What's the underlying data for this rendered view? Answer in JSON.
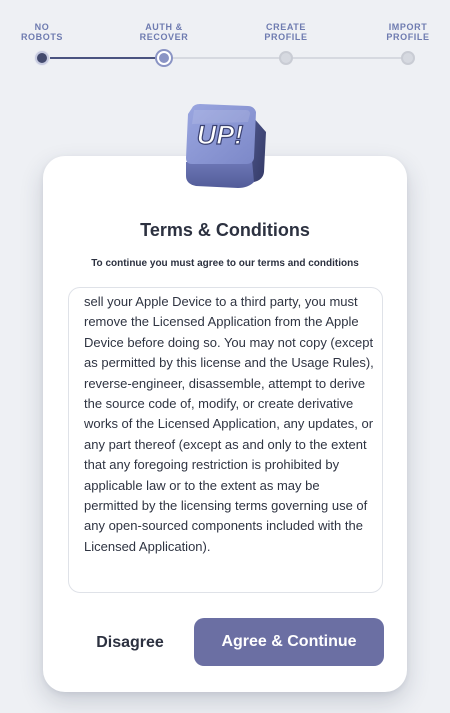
{
  "stepper": {
    "steps": [
      {
        "label": "NO\nROBOTS",
        "state": "complete"
      },
      {
        "label": "AUTH &\nRECOVER",
        "state": "current"
      },
      {
        "label": "CREATE\nPROFILE",
        "state": "pending"
      },
      {
        "label": "IMPORT\nPROFILE",
        "state": "pending"
      }
    ]
  },
  "logo": {
    "text": "UP!",
    "icon": "up-cube-logo-icon"
  },
  "dialog": {
    "title": "Terms & Conditions",
    "subtitle": "To continue you must agree to our terms and conditions",
    "terms_text": "sell your Apple Device to a third party, you must remove the Licensed Application from the Apple Device before doing so. You may not copy (except as permitted by this license and the Usage Rules), reverse-engineer, disassemble, attempt to derive the source code of, modify, or create derivative works of the Licensed Application, any updates, or any part thereof (except as and only to the extent that any foregoing restriction is prohibited by applicable law or to the extent as may be permitted by the licensing terms governing use of any open-sourced components included with the Licensed Application)."
  },
  "buttons": {
    "disagree_label": "Disagree",
    "agree_label": "Agree & Continue"
  },
  "colors": {
    "accent": "#6b6fa3",
    "step_complete": "#434a6e",
    "step_current": "#8a94c4",
    "step_pending": "#d6d9e0",
    "background": "#eef0f4"
  }
}
